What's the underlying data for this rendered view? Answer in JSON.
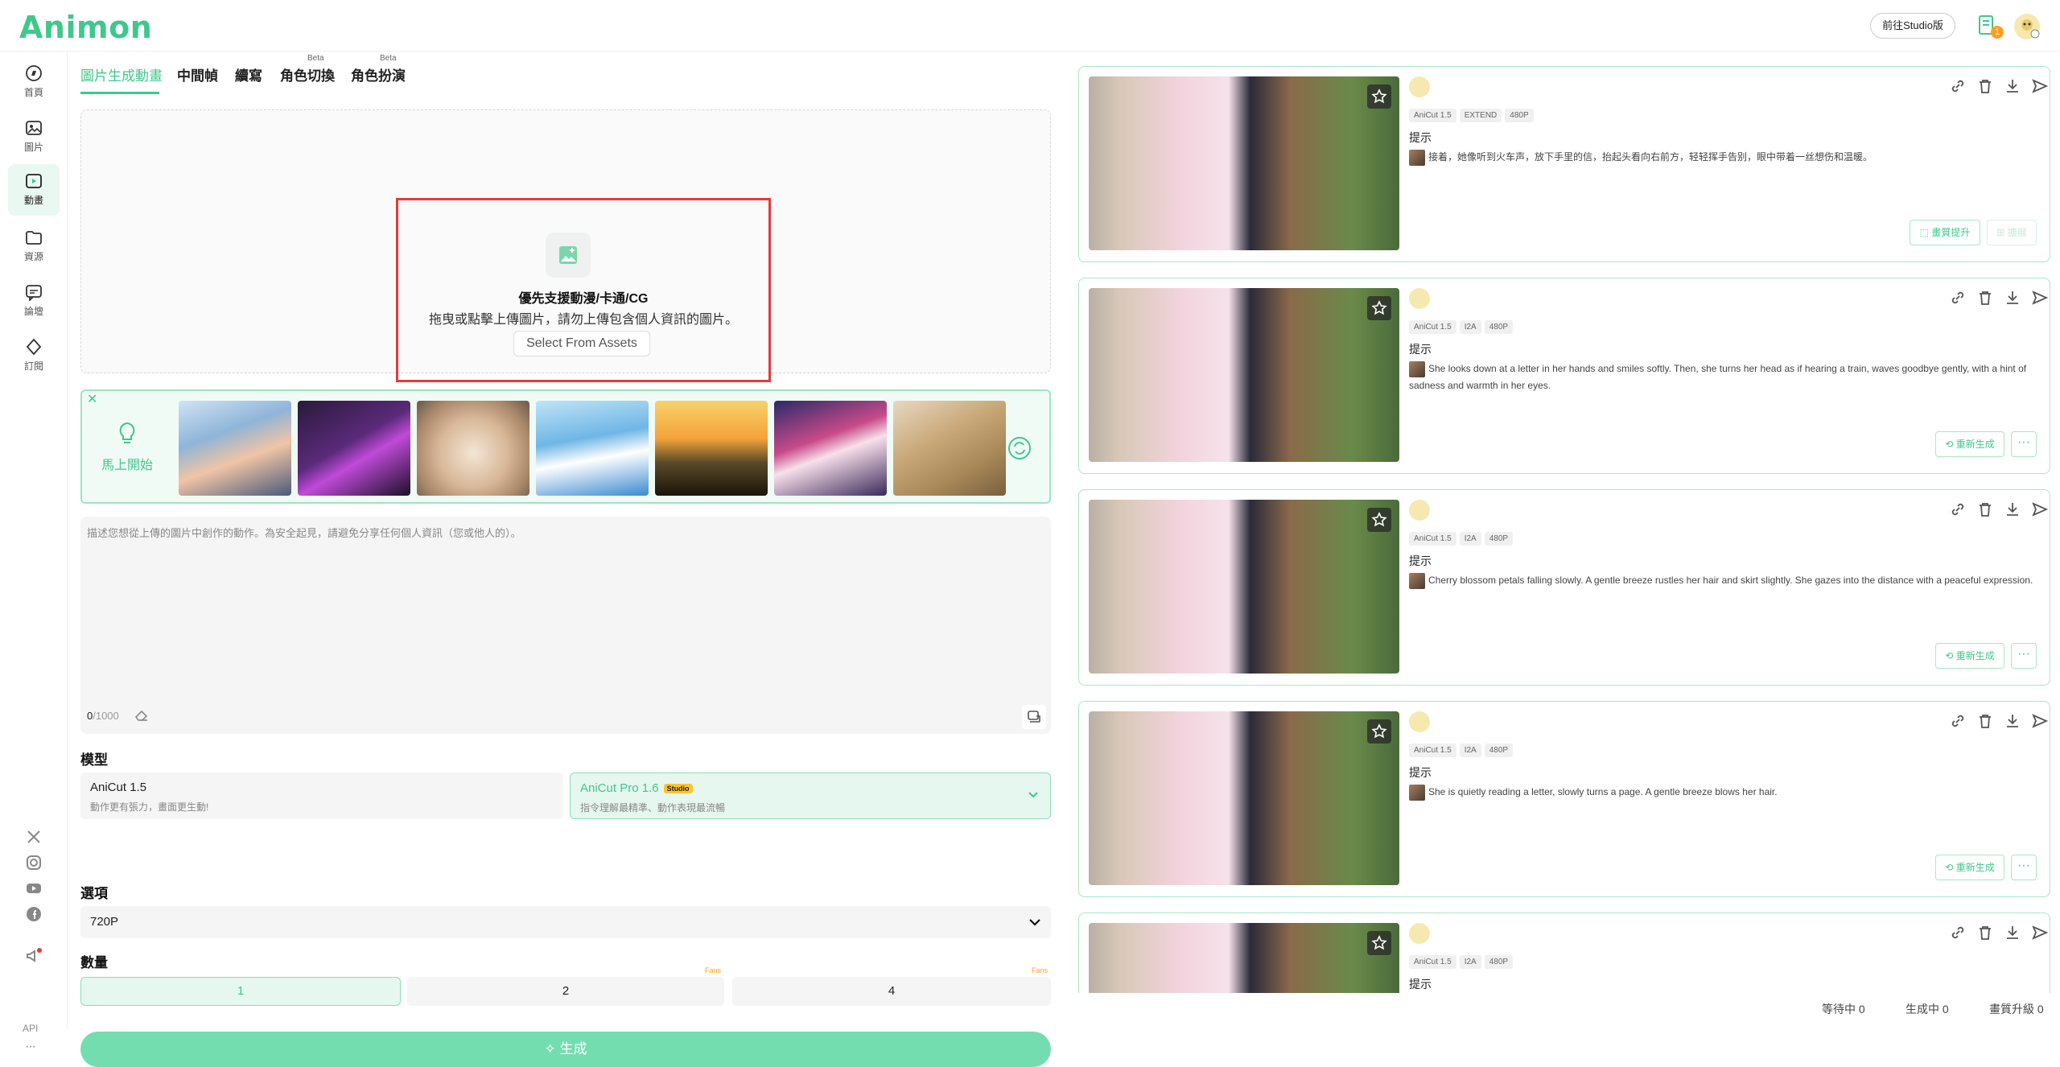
{
  "header": {
    "logo": "Animon",
    "studio_button": "前往Studio版",
    "notification_count": "1"
  },
  "sidebar": {
    "items": [
      {
        "label": "首頁",
        "icon": "compass-icon"
      },
      {
        "label": "圖片",
        "icon": "image-icon"
      },
      {
        "label": "動畫",
        "icon": "video-icon"
      },
      {
        "label": "資源",
        "icon": "folder-icon"
      },
      {
        "label": "論壇",
        "icon": "chat-icon"
      },
      {
        "label": "訂閱",
        "icon": "diamond-icon"
      }
    ],
    "api_label": "API"
  },
  "tabs": [
    {
      "label": "圖片生成動畫",
      "beta": ""
    },
    {
      "label": "中間幀",
      "beta": ""
    },
    {
      "label": "續寫",
      "beta": ""
    },
    {
      "label": "角色切換",
      "beta": "Beta"
    },
    {
      "label": "角色扮演",
      "beta": "Beta"
    }
  ],
  "upload": {
    "title": "優先支援動漫/卡通/CG",
    "desc": "拖曳或點擊上傳圖片，請勿上傳包含個人資訊的圖片。",
    "assets_button": "Select From Assets"
  },
  "samples": {
    "start_label": "馬上開始"
  },
  "prompt": {
    "placeholder": "描述您想從上傳的圖片中創作的動作。為安全起見，請避免分享任何個人資訊（您或他人的）。",
    "count": "0",
    "max": "/1000"
  },
  "model": {
    "label": "模型",
    "options": [
      {
        "name": "AniCut 1.5",
        "desc": "動作更有張力，畫面更生動!",
        "tag": ""
      },
      {
        "name": "AniCut Pro 1.6",
        "desc": "指令理解最精準、動作表現最流暢",
        "tag": "Studio"
      }
    ]
  },
  "options": {
    "label": "選項",
    "resolution": "720P"
  },
  "quantity": {
    "label": "數量",
    "values": [
      "1",
      "2",
      "4"
    ],
    "fans_tag": "Fans"
  },
  "generate_button": "生成",
  "cards": [
    {
      "tags": [
        "AniCut 1.5",
        "EXTEND",
        "480P"
      ],
      "label": "提示",
      "prompt": "接着，她像听到火车声，放下手里的信，抬起头看向右前方，轻轻挥手告别，眼中带着一丝想伤和温暖。",
      "buttons": [
        "畫質提升",
        "擴展"
      ]
    },
    {
      "tags": [
        "AniCut 1.5",
        "I2A",
        "480P"
      ],
      "label": "提示",
      "prompt": "She looks down at a letter in her hands and smiles softly. Then, she turns her head as if hearing a train, waves goodbye gently, with a hint of sadness and warmth in her eyes.",
      "buttons": [
        "重新生成"
      ]
    },
    {
      "tags": [
        "AniCut 1.5",
        "I2A",
        "480P"
      ],
      "label": "提示",
      "prompt": "Cherry blossom petals falling slowly. A gentle breeze rustles her hair and skirt slightly. She gazes into the distance with a peaceful expression.",
      "buttons": [
        "重新生成"
      ]
    },
    {
      "tags": [
        "AniCut 1.5",
        "I2A",
        "480P"
      ],
      "label": "提示",
      "prompt": "She is quietly reading a letter, slowly turns a page. A gentle breeze blows her hair.",
      "buttons": [
        "重新生成"
      ]
    },
    {
      "tags": [
        "AniCut 1.5",
        "I2A",
        "480P"
      ],
      "label": "提示",
      "prompt": "",
      "buttons": []
    }
  ],
  "status": {
    "waiting": "等待中 0",
    "generating": "生成中 0",
    "upscaling": "畫質升級 0"
  },
  "colors": {
    "accent": "#3fc88c",
    "highlight_border": "#e63a3a",
    "card_border": "#a9e6c8"
  }
}
